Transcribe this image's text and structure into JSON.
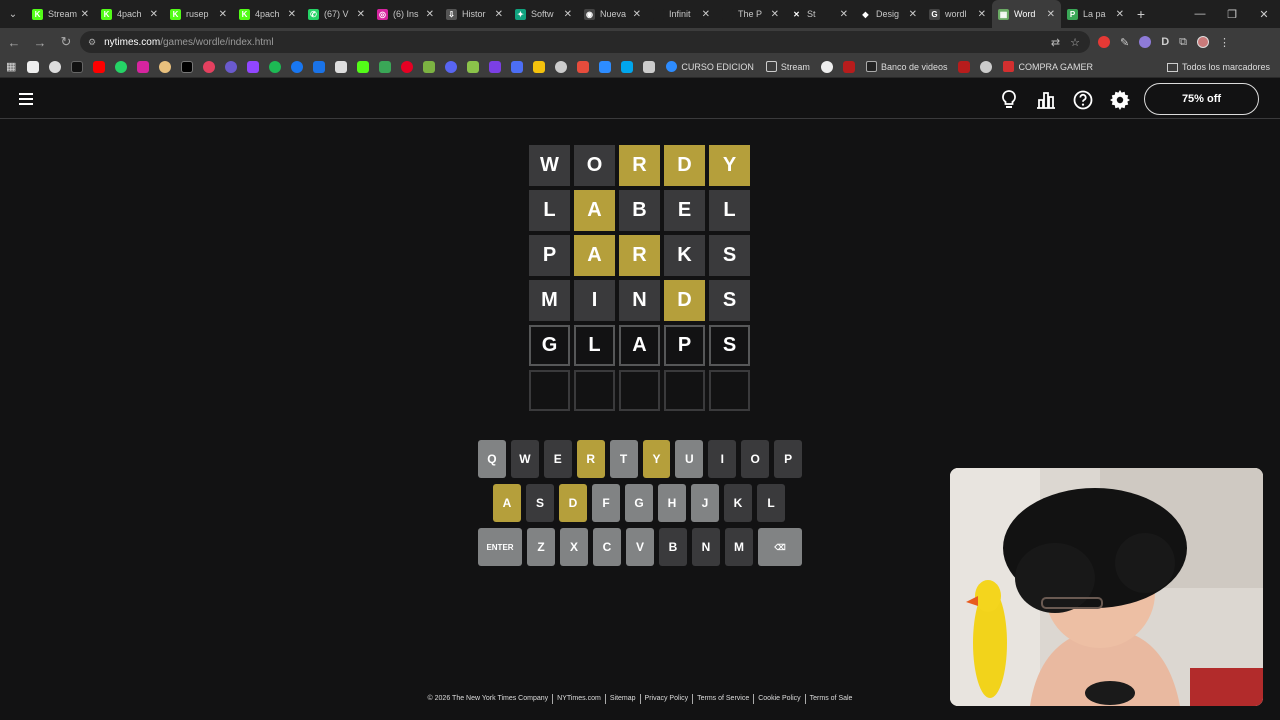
{
  "browser": {
    "tabs": [
      {
        "title": "Stream",
        "color": "#53fc18",
        "glyph": "K"
      },
      {
        "title": "4pach",
        "color": "#53fc18",
        "glyph": "K"
      },
      {
        "title": "rusep",
        "color": "#53fc18",
        "glyph": "K"
      },
      {
        "title": "4pach",
        "color": "#53fc18",
        "glyph": "K"
      },
      {
        "title": "(67) V",
        "color": "#25d366",
        "glyph": "✆"
      },
      {
        "title": "(6) Ins",
        "color": "#d6249f",
        "glyph": "◎"
      },
      {
        "title": "Histor",
        "color": "#555",
        "glyph": "⇩"
      },
      {
        "title": "Softw",
        "color": "#10a37f",
        "glyph": "✦"
      },
      {
        "title": "Nueva",
        "color": "#444",
        "glyph": "◉"
      },
      {
        "title": "Infinit",
        "color": "#1f1f1f",
        "glyph": ""
      },
      {
        "title": "The P",
        "color": "#1f1f1f",
        "glyph": ""
      },
      {
        "title": "St",
        "color": "#1f1f1f",
        "glyph": "✕"
      },
      {
        "title": "Desig",
        "color": "#1f1f1f",
        "glyph": "◆"
      },
      {
        "title": "wordl",
        "color": "#444",
        "glyph": "G"
      },
      {
        "title": "Word",
        "color": "#6aaa64",
        "glyph": "▦",
        "active": true
      },
      {
        "title": "La pa",
        "color": "#3aa757",
        "glyph": "P"
      }
    ],
    "url_host": "nytimes.com",
    "url_path": "/games/wordle/index.html",
    "bookmarks": {
      "curso": "CURSO EDICION",
      "stream": "Stream",
      "banco": "Banco de videos",
      "compra": "COMPRA GAMER",
      "all": "Todos los marcadores"
    }
  },
  "game": {
    "subscribe_label": "75% off",
    "board": [
      [
        {
          "l": "W",
          "s": "absent"
        },
        {
          "l": "O",
          "s": "absent"
        },
        {
          "l": "R",
          "s": "present"
        },
        {
          "l": "D",
          "s": "present"
        },
        {
          "l": "Y",
          "s": "present"
        }
      ],
      [
        {
          "l": "L",
          "s": "absent"
        },
        {
          "l": "A",
          "s": "present"
        },
        {
          "l": "B",
          "s": "absent"
        },
        {
          "l": "E",
          "s": "absent"
        },
        {
          "l": "L",
          "s": "absent"
        }
      ],
      [
        {
          "l": "P",
          "s": "absent"
        },
        {
          "l": "A",
          "s": "present"
        },
        {
          "l": "R",
          "s": "present"
        },
        {
          "l": "K",
          "s": "absent"
        },
        {
          "l": "S",
          "s": "absent"
        }
      ],
      [
        {
          "l": "M",
          "s": "absent"
        },
        {
          "l": "I",
          "s": "absent"
        },
        {
          "l": "N",
          "s": "absent"
        },
        {
          "l": "D",
          "s": "present"
        },
        {
          "l": "S",
          "s": "absent"
        }
      ],
      [
        {
          "l": "G",
          "s": "tbd"
        },
        {
          "l": "L",
          "s": "tbd"
        },
        {
          "l": "A",
          "s": "tbd"
        },
        {
          "l": "P",
          "s": "tbd"
        },
        {
          "l": "S",
          "s": "tbd"
        }
      ],
      [
        {
          "l": "",
          "s": "empty"
        },
        {
          "l": "",
          "s": "empty"
        },
        {
          "l": "",
          "s": "empty"
        },
        {
          "l": "",
          "s": "empty"
        },
        {
          "l": "",
          "s": "empty"
        }
      ]
    ],
    "keyboard": [
      [
        {
          "k": "Q",
          "s": "unused"
        },
        {
          "k": "W",
          "s": "absent"
        },
        {
          "k": "E",
          "s": "absent"
        },
        {
          "k": "R",
          "s": "present"
        },
        {
          "k": "T",
          "s": "unused"
        },
        {
          "k": "Y",
          "s": "present"
        },
        {
          "k": "U",
          "s": "unused"
        },
        {
          "k": "I",
          "s": "absent"
        },
        {
          "k": "O",
          "s": "absent"
        },
        {
          "k": "P",
          "s": "absent"
        }
      ],
      [
        {
          "k": "A",
          "s": "present"
        },
        {
          "k": "S",
          "s": "absent"
        },
        {
          "k": "D",
          "s": "present"
        },
        {
          "k": "F",
          "s": "unused"
        },
        {
          "k": "G",
          "s": "unused"
        },
        {
          "k": "H",
          "s": "unused"
        },
        {
          "k": "J",
          "s": "unused"
        },
        {
          "k": "K",
          "s": "absent"
        },
        {
          "k": "L",
          "s": "absent"
        }
      ],
      [
        {
          "k": "ENTER",
          "s": "unused",
          "wide": true
        },
        {
          "k": "Z",
          "s": "unused"
        },
        {
          "k": "X",
          "s": "unused"
        },
        {
          "k": "C",
          "s": "unused"
        },
        {
          "k": "V",
          "s": "unused"
        },
        {
          "k": "B",
          "s": "absent"
        },
        {
          "k": "N",
          "s": "absent"
        },
        {
          "k": "M",
          "s": "absent"
        },
        {
          "k": "⌫",
          "s": "unused",
          "wide": true
        }
      ]
    ],
    "footer": [
      "© 2026 The New York Times Company",
      "NYTimes.com",
      "Sitemap",
      "Privacy Policy",
      "Terms of Service",
      "Cookie Policy",
      "Terms of Sale"
    ]
  },
  "colors": {
    "absent": "#3a3a3c",
    "present": "#b59f3b",
    "unused": "#818384",
    "background": "#121213"
  }
}
